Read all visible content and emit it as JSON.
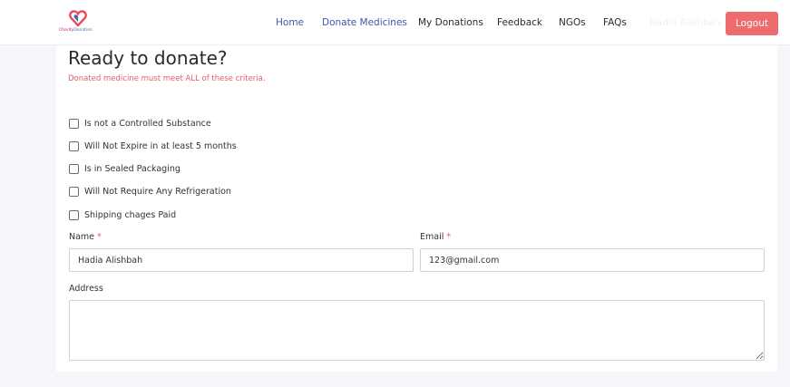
{
  "brand": {
    "name_part1": "Charity",
    "name_part2": "Donation",
    "heart_color": "#e74a5a",
    "heart_color2": "#3d6bb4"
  },
  "nav": {
    "items": [
      {
        "label": "Home",
        "active": true
      },
      {
        "label": "Donate Medicines",
        "active": true
      },
      {
        "label": "My Donations",
        "active": false
      },
      {
        "label": "Feedback",
        "active": false
      },
      {
        "label": "NGOs",
        "active": false
      },
      {
        "label": "FAQs",
        "active": false
      }
    ],
    "user_name": "Hadia Alishbah",
    "logout_label": "Logout",
    "logout_color": "#ee6b6e"
  },
  "form": {
    "title": "Ready to donate?",
    "subtitle": "Donated medicine must meet ALL of these criteria.",
    "criteria": [
      {
        "label": "Is not a Controlled Substance",
        "checked": false
      },
      {
        "label": "Will Not Expire in at least 5 months",
        "checked": false
      },
      {
        "label": "Is in Sealed Packaging",
        "checked": false
      },
      {
        "label": "Will Not Require Any Refrigeration",
        "checked": false
      },
      {
        "label": "Shipping chages Paid",
        "checked": false
      }
    ],
    "name_label": "Name",
    "name_value": "Hadia Alishbah",
    "email_label": "Email",
    "email_value": "123@gmail.com",
    "required_mark": "*",
    "address_label": "Address",
    "address_value": ""
  }
}
